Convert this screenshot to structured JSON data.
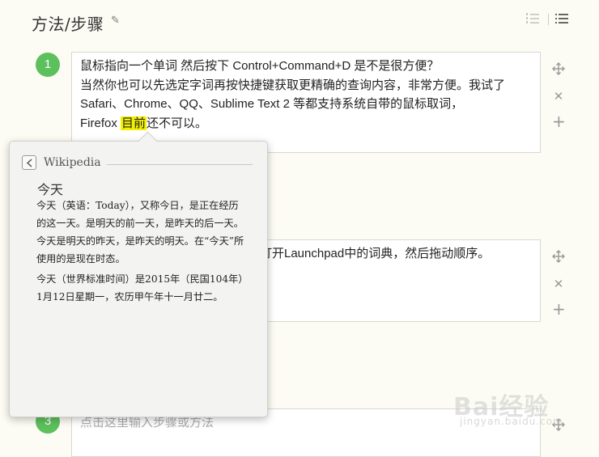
{
  "header": {
    "title": "方法/步骤"
  },
  "steps": [
    {
      "number": "1",
      "lines": [
        "鼠标指向一个单词 然后按下 Control+Command+D 是不是很方便？",
        "当然你也可以先选定字词再按快捷键获取更精确的查询内容，非常方便。我试了",
        "Safari、Chrome、QQ、Sublime Text 2 等都支持系统自带的鼠标取词，"
      ],
      "last_line_prefix": "Firefox ",
      "last_line_highlight": "目前",
      "last_line_suffix": "还不可以。"
    },
    {
      "visible_text": "打开Launchpad中的词典，然后拖动顺序。"
    },
    {
      "number": "3",
      "placeholder": "点击这里输入步骤或方法"
    }
  ],
  "popup": {
    "source": "Wikipedia",
    "entry_title": "今天",
    "paragraphs": [
      "今天（英语：Today），又称今日，是正在经历的这一天。是明天的前一天，是昨天的后一天。今天是明天的昨天，是昨天的明天。在“今天”所使用的是现在时态。",
      "今天（世界标准时间）是2015年（民国104年）1月12日星期一，农历甲午年十一月廿二。"
    ]
  },
  "watermark": {
    "text": "Bai经验",
    "sub": "jingyan.baidu.com"
  },
  "colors": {
    "accent_green": "#5cc05c",
    "highlight": "#f5f000",
    "background": "#fdfcf4"
  }
}
